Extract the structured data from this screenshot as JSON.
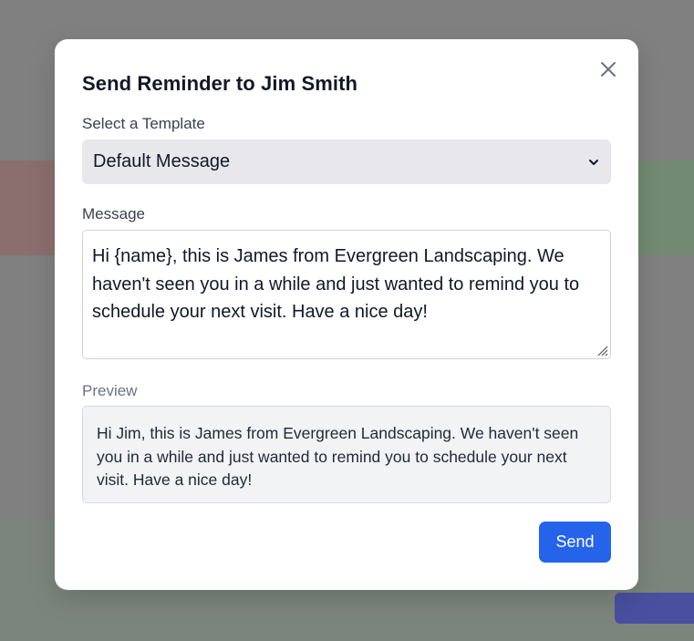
{
  "modal": {
    "title": "Send Reminder to Jim Smith",
    "close_icon": "close-icon",
    "template": {
      "label": "Select a Template",
      "selected": "Default Message",
      "icon": "chevron-down-icon"
    },
    "message": {
      "label": "Message",
      "value": "Hi {name}, this is James from Evergreen Landscaping. We haven't seen you in a while and just wanted to remind you to schedule your next visit. Have a nice day!"
    },
    "preview": {
      "label": "Preview",
      "text": "Hi Jim, this is James from Evergreen Landscaping. We haven't seen you in a while and just wanted to remind you to schedule your next visit. Have a nice day!"
    },
    "send_label": "Send"
  },
  "colors": {
    "primary": "#2563eb",
    "overlay": "#808080",
    "select_bg": "#e8e8ec",
    "preview_bg": "#f2f3f5"
  }
}
